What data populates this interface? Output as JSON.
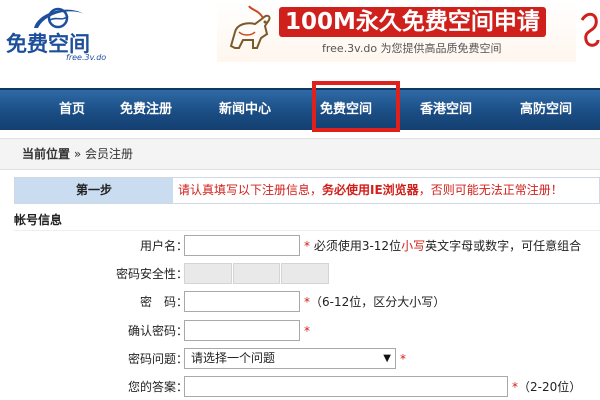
{
  "logo": {
    "title": "免费空间",
    "subtitle": "free.3v.do"
  },
  "banner": {
    "title": "100M永久免费空间申请",
    "subtitle": "free.3v.do 为您提供高品质免费空间"
  },
  "nav": {
    "items": [
      {
        "label": "首页"
      },
      {
        "label": "免费注册"
      },
      {
        "label": "新闻中心"
      },
      {
        "label": "免费空间",
        "highlighted": true
      },
      {
        "label": "香港空间"
      },
      {
        "label": "高防空间"
      }
    ]
  },
  "breadcrumb": {
    "label": "当前位置",
    "separator": "»",
    "current": "会员注册"
  },
  "step": {
    "label": "第一步",
    "note_prefix": "请认真填写以下注册信息，",
    "note_bold": "务必使用IE浏览器",
    "note_suffix": "，否则可能无法正常注册！"
  },
  "section": {
    "title": "帐号信息"
  },
  "form": {
    "username": {
      "label": "用户名：",
      "required": "*",
      "hint_a": "必须使用3-12位",
      "hint_red": "小写",
      "hint_b": "英文字母或数字，可任意组合"
    },
    "strength": {
      "label": "密码安全性："
    },
    "password": {
      "label": "密　码：",
      "required": "*",
      "hint": "（6-12位，区分大小写）"
    },
    "confirm": {
      "label": "确认密码：",
      "required": "*"
    },
    "question": {
      "label": "密码问题：",
      "selected": "请选择一个问题",
      "required": "*"
    },
    "answer": {
      "label": "您的答案：",
      "required": "*",
      "hint": "（2-20位）"
    }
  },
  "colors": {
    "brand_blue": "#1e4f9c",
    "nav_blue": "#1a4d84",
    "accent_red": "#d0201c",
    "step_bg": "#c9dcf0"
  }
}
